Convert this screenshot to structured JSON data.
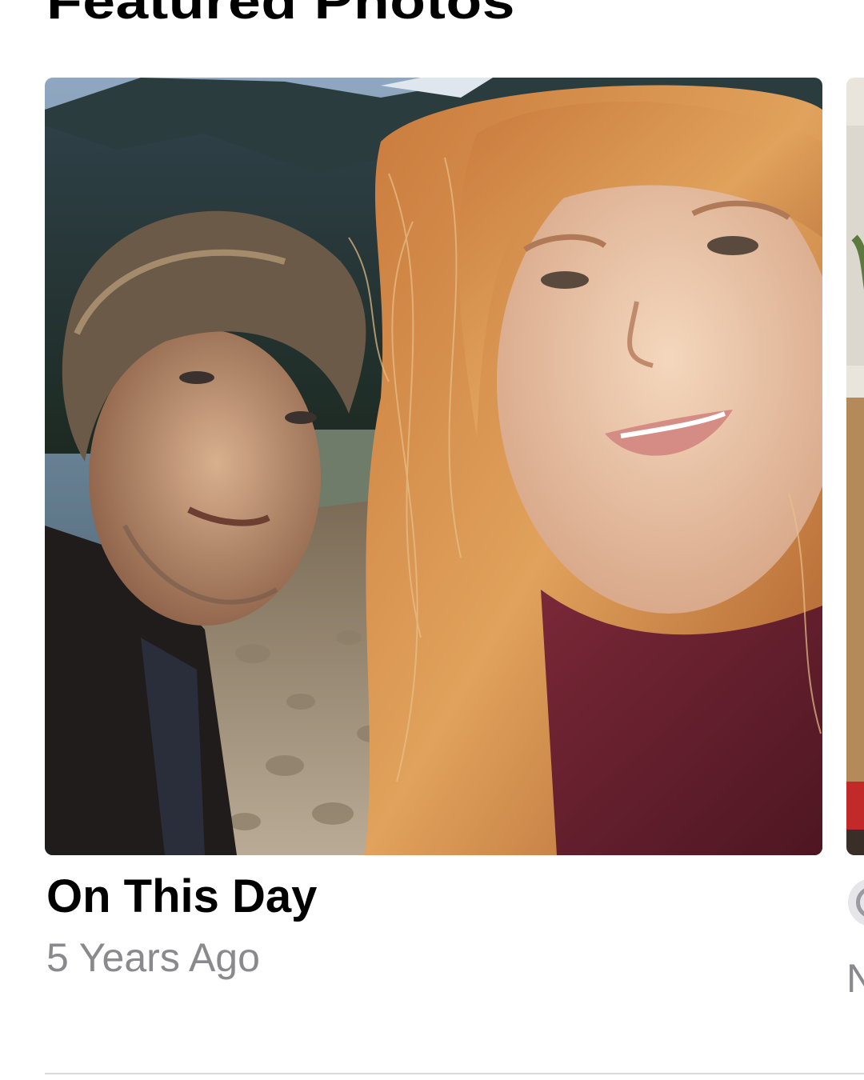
{
  "section": {
    "title": "Featured Photos"
  },
  "featured_card": {
    "title": "On This Day",
    "subtitle": "5 Years Ago",
    "photo_description_icon": "selfie-photo"
  },
  "next_card": {
    "peek_letter": "N",
    "icon": "people-icon"
  },
  "colors": {
    "subtitle_gray": "#8a8a8e",
    "divider": "#d9d9dc"
  }
}
